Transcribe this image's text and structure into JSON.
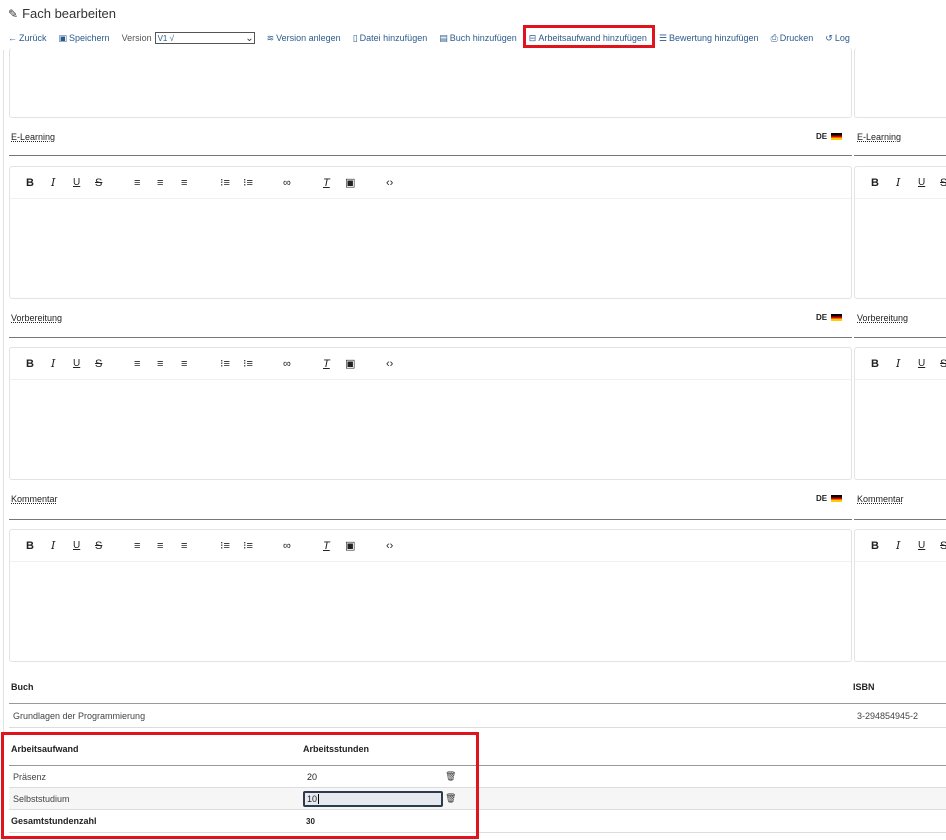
{
  "header": {
    "title": "Fach bearbeiten",
    "edit_icon": "pencil-icon"
  },
  "toolbar": {
    "back": "Zurück",
    "save": "Speichern",
    "version_label": "Version",
    "version_value": "V1 √",
    "create_version": "Version anlegen",
    "add_file": "Datei hinzufügen",
    "add_book": "Buch hinzufügen",
    "add_workload": "Arbeitsaufwand hinzufügen",
    "add_rating": "Bewertung hinzufügen",
    "print": "Drucken",
    "log": "Log"
  },
  "sections": {
    "elearning": "E-Learning",
    "preparation": "Vorbereitung",
    "comment": "Kommentar",
    "lang": "DE"
  },
  "editor": {
    "bold": "B",
    "italic": "I",
    "underline": "U",
    "strike": "S",
    "clear": "T"
  },
  "books": {
    "header_book": "Buch",
    "header_isbn": "ISBN",
    "rows": [
      {
        "title": "Grundlagen der Programmierung",
        "isbn": "3-294854945-2"
      }
    ]
  },
  "workload": {
    "header_type": "Arbeitsaufwand",
    "header_hours": "Arbeitsstunden",
    "rows": [
      {
        "type": "Präsenz",
        "hours": "20"
      },
      {
        "type": "Selbststudium",
        "hours": "10"
      }
    ],
    "total_label": "Gesamtstundenzahl",
    "total_value": "30"
  }
}
